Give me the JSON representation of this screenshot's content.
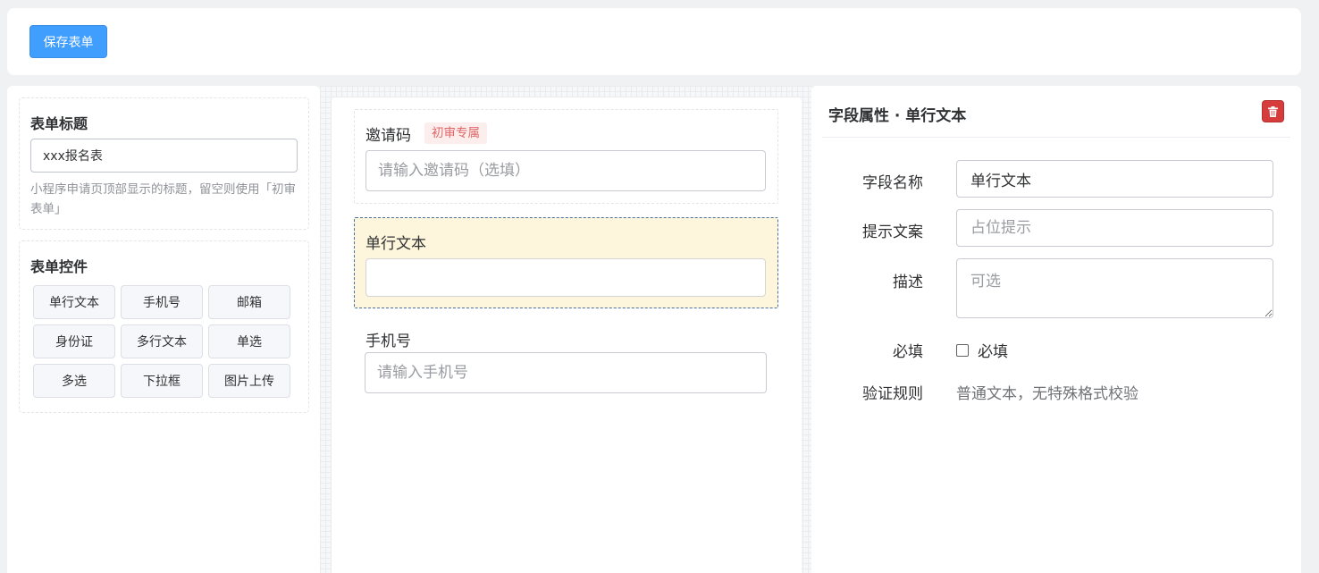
{
  "toolbar": {
    "save_label": "保存表单"
  },
  "left": {
    "title_card": {
      "heading": "表单标题",
      "input_value": "xxx报名表",
      "hint": "小程序申请页顶部显示的标题，留空则使用「初审表单」"
    },
    "controls_card": {
      "heading": "表单控件",
      "items": [
        "单行文本",
        "手机号",
        "邮箱",
        "身份证",
        "多行文本",
        "单选",
        "多选",
        "下拉框",
        "图片上传"
      ]
    }
  },
  "canvas": {
    "fields": [
      {
        "label": "邀请码",
        "tag": "初审专属",
        "placeholder": "请输入邀请码（选填）"
      },
      {
        "label": "单行文本",
        "placeholder": ""
      },
      {
        "label": "手机号",
        "placeholder": "请输入手机号"
      }
    ]
  },
  "props": {
    "title": "字段属性 · 单行文本",
    "delete_icon": "trash-icon",
    "name_label": "字段名称",
    "name_value": "单行文本",
    "placeholder_label": "提示文案",
    "placeholder_placeholder": "占位提示",
    "desc_label": "描述",
    "desc_placeholder": "可选",
    "required_label": "必填",
    "required_checkbox_label": "必填",
    "rule_label": "验证规则",
    "rule_value": "普通文本，无特殊格式校验"
  },
  "colors": {
    "primary": "#409eff",
    "danger": "#d63c3c",
    "selected_field_bg": "#fdf6dc",
    "tag_text": "#e06767"
  }
}
